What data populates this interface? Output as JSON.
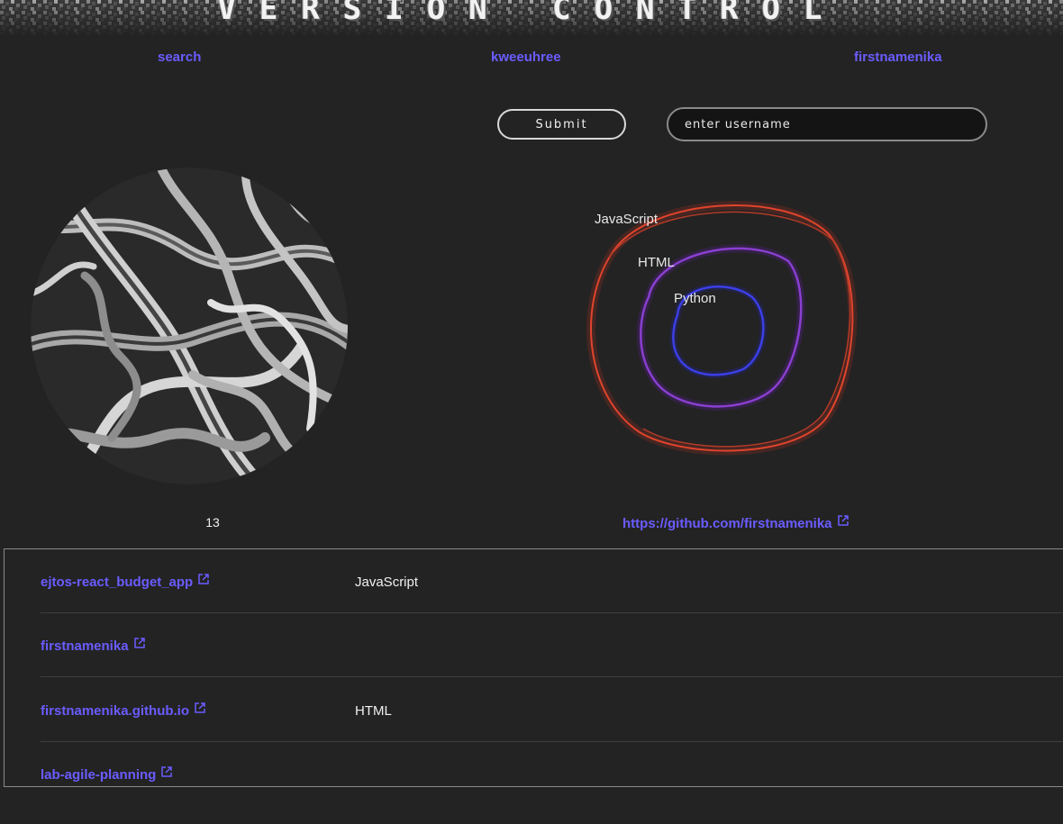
{
  "header": {
    "title": "VERSION CONTROL"
  },
  "nav": {
    "search_label": "search",
    "user1_label": "kweeuhree",
    "user2_label": "firstnamenika"
  },
  "form": {
    "submit_label": "Submit",
    "username_placeholder": "enter username",
    "username_value": ""
  },
  "profile": {
    "repo_count": "13",
    "url": "https://github.com/firstnamenika"
  },
  "languages": {
    "items": [
      {
        "label": "JavaScript",
        "color": "#e0442c"
      },
      {
        "label": "HTML",
        "color": "#8a3fd0"
      },
      {
        "label": "Python",
        "color": "#3c3fe6"
      }
    ]
  },
  "repos": [
    {
      "name": "ejtos-react_budget_app",
      "language": "JavaScript"
    },
    {
      "name": "firstnamenika",
      "language": ""
    },
    {
      "name": "firstnamenika.github.io",
      "language": "HTML"
    },
    {
      "name": "lab-agile-planning",
      "language": ""
    }
  ],
  "colors": {
    "background": "#232323",
    "link": "#6a5cff",
    "text": "#f0f0f0"
  }
}
